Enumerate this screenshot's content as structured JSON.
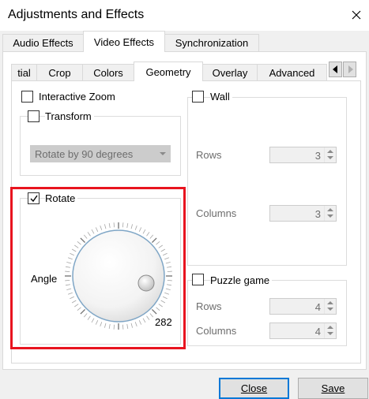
{
  "window": {
    "title": "Adjustments and Effects"
  },
  "outer_tabs": [
    "Audio Effects",
    "Video Effects",
    "Synchronization"
  ],
  "inner_tabs": [
    "tial",
    "Crop",
    "Colors",
    "Geometry",
    "Overlay",
    "Advanced"
  ],
  "geometry": {
    "interactive_zoom": {
      "label": "Interactive Zoom",
      "checked": false
    },
    "transform": {
      "label": "Transform",
      "checked": false,
      "select_value": "Rotate by 90 degrees"
    },
    "rotate": {
      "label": "Rotate",
      "checked": true,
      "angle_label": "Angle",
      "angle_value": "282"
    },
    "wall": {
      "label": "Wall",
      "checked": false,
      "rows_label": "Rows",
      "rows_value": "3",
      "columns_label": "Columns",
      "columns_value": "3"
    },
    "puzzle": {
      "label": "Puzzle game",
      "checked": false,
      "rows_label": "Rows",
      "rows_value": "4",
      "columns_label": "Columns",
      "columns_value": "4"
    }
  },
  "buttons": {
    "close_label": "Close",
    "save_label": "Save"
  },
  "colors": {
    "highlight": "#e8141f",
    "focus": "#0078d7"
  }
}
